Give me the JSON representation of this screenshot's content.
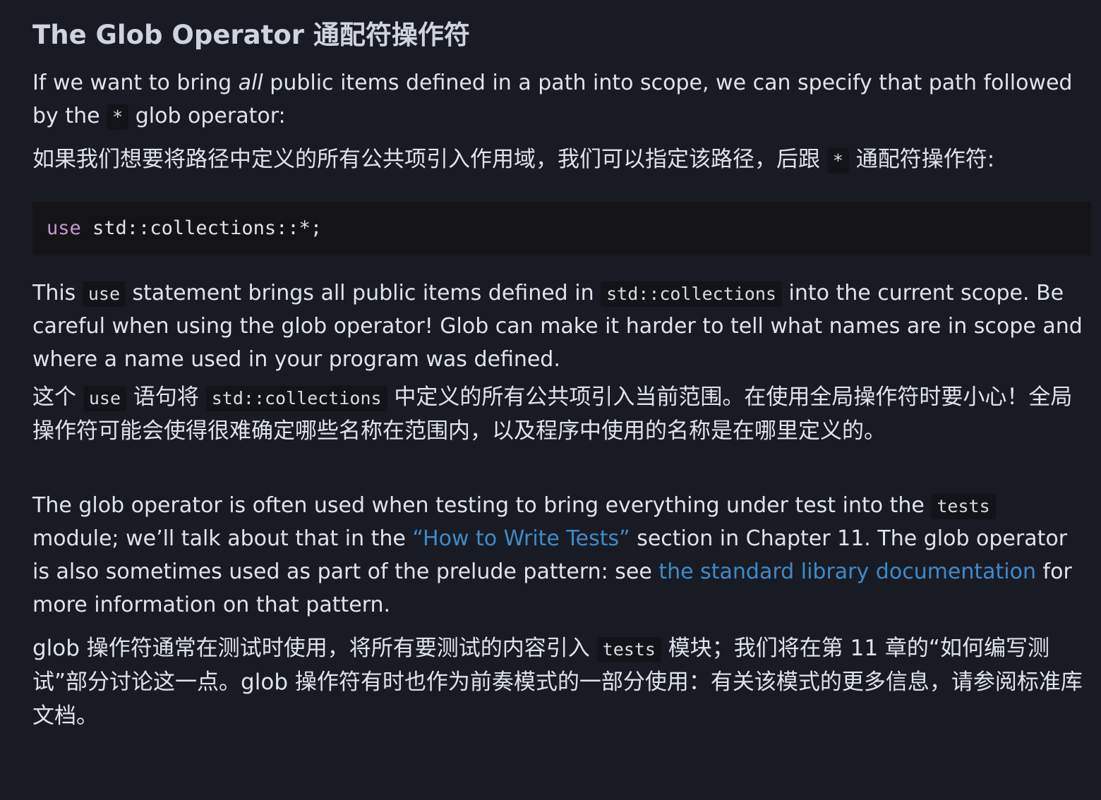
{
  "heading": "The Glob Operator 通配符操作符",
  "para1": {
    "t1": "If we want to bring ",
    "em": "all",
    "t2": " public items defined in a path into scope, we can specify that path followed by the ",
    "code": "*",
    "t3": " glob operator:"
  },
  "para1_cn": {
    "t1": "如果我们想要将路径中定义的所有公共项引入作用域，我们可以指定该路径，后跟 ",
    "code": "*",
    "t2": " 通配符操作符:"
  },
  "code_block": {
    "keyword": "use",
    "rest": " std::collections::*;"
  },
  "para2": {
    "t1": "This ",
    "code1": "use",
    "t2": " statement brings all public items defined in ",
    "code2": "std::collections",
    "t3": " into the current scope. Be careful when using the glob operator! Glob can make it harder to tell what names are in scope and where a name used in your program was defined."
  },
  "para2_cn": {
    "t1": "这个 ",
    "code1": "use",
    "t2": " 语句将 ",
    "code2": "std::collections",
    "t3": " 中定义的所有公共项引入当前范围。在使用全局操作符时要小心！全局操作符可能会使得很难确定哪些名称在范围内，以及程序中使用的名称是在哪里定义的。"
  },
  "para3": {
    "t1": "The glob operator is often used when testing to bring everything under test into the ",
    "code": "tests",
    "t2": " module; we’ll talk about that in the ",
    "link1": "“How to Write Tests”",
    "t3": " section in Chapter 11. The glob operator is also sometimes used as part of the prelude pattern: see ",
    "link2": "the standard library documentation",
    "t4": " for more information on that pattern."
  },
  "para3_cn": {
    "t1": "glob 操作符通常在测试时使用，将所有要测试的内容引入 ",
    "code": "tests",
    "t2": " 模块；我们将在第 11 章的“如何编写测试”部分讨论这一点。glob 操作符有时也作为前奏模式的一部分使用：有关该模式的更多信息，请参阅标准库文档。"
  },
  "colors": {
    "background": "#191b24",
    "text": "#dfe3ec",
    "code_background": "#111418",
    "keyword": "#c49ad6",
    "link": "#3f8ac7"
  }
}
